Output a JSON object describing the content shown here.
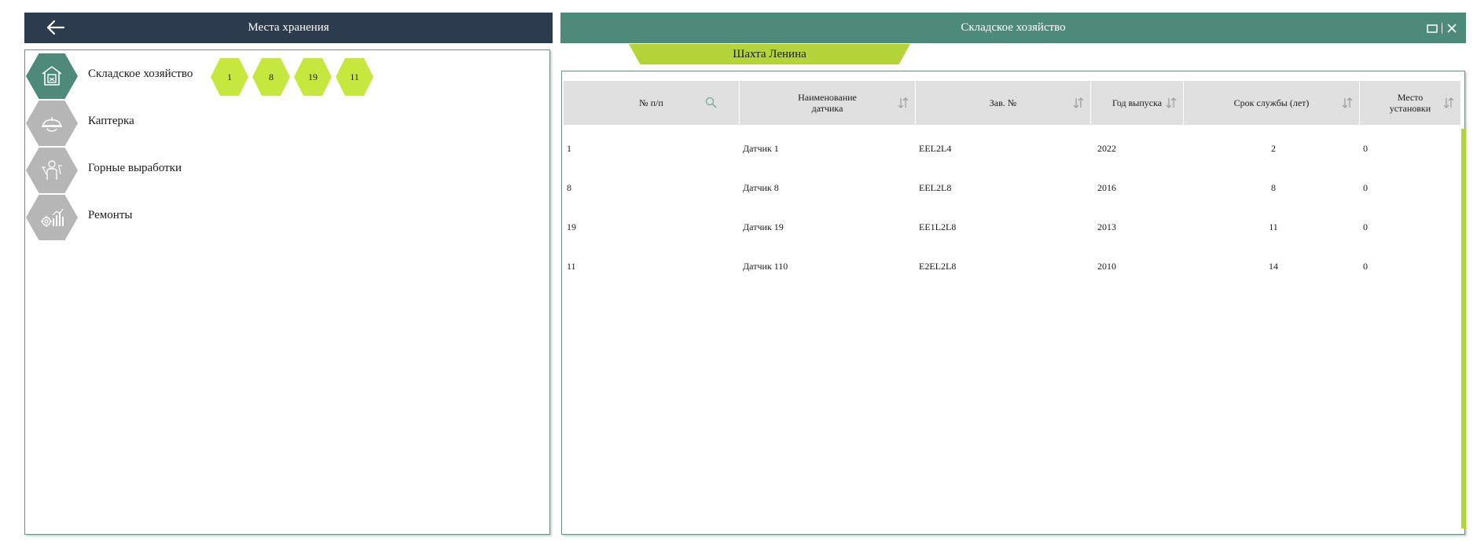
{
  "left_panel": {
    "title": "Места хранения",
    "nav": [
      {
        "label": "Складское хозяйство",
        "icon": "warehouse-icon",
        "active": true,
        "badges": [
          "1",
          "8",
          "19",
          "11"
        ]
      },
      {
        "label": "Каптерка",
        "icon": "hard-hat-icon",
        "active": false
      },
      {
        "label": "Горные выработки",
        "icon": "miner-icon",
        "active": false
      },
      {
        "label": "Ремонты",
        "icon": "gear-chart-icon",
        "active": false
      }
    ]
  },
  "right_panel": {
    "title": "Складское хозяйство",
    "mine_tab": "Шахта Ленина",
    "columns": [
      "№ п/п",
      "Наименование датчика",
      "Зав. №",
      "Год выпуска",
      "Срок службы (лет)",
      "Место установки"
    ],
    "rows": [
      [
        "1",
        "Датчик 1",
        "EEL2L4",
        "2022",
        "2",
        "0"
      ],
      [
        "8",
        "Датчик 8",
        "EEL2L8",
        "2016",
        "8",
        "0"
      ],
      [
        "19",
        "Датчик 19",
        "EE1L2L8",
        "2013",
        "11",
        "0"
      ],
      [
        "11",
        "Датчик 110",
        "E2EL2L8",
        "2010",
        "14",
        "0"
      ]
    ]
  },
  "colors": {
    "left_header": "#2d3b4e",
    "right_header": "#4e8a7a",
    "accent_green": "#c6e83e",
    "tab_green": "#b4d43a",
    "table_header": "#e0e0e0"
  }
}
